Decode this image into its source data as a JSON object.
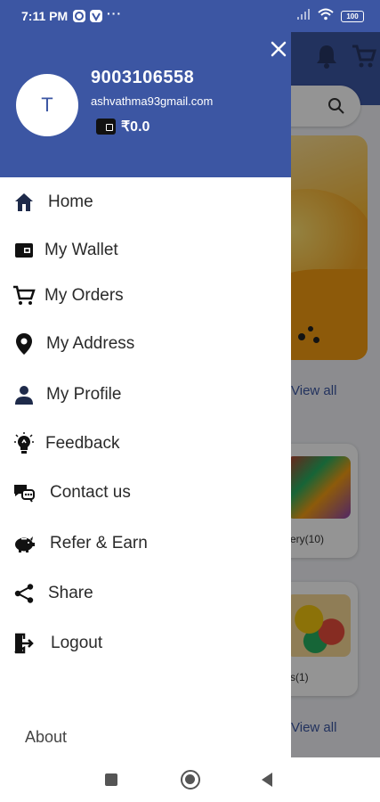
{
  "status_bar": {
    "time": "7:11 PM",
    "more_indicator": "···",
    "battery": "100"
  },
  "drawer": {
    "avatar_initial": "T",
    "phone": "9003106558",
    "email": "ashvathma93gmail.com",
    "balance": "₹0.0",
    "menu": [
      {
        "label": "Home",
        "icon": "home-icon"
      },
      {
        "label": "My Wallet",
        "icon": "wallet-icon"
      },
      {
        "label": "My Orders",
        "icon": "cart-icon"
      },
      {
        "label": "My Address",
        "icon": "location-pin-icon"
      },
      {
        "label": "My Profile",
        "icon": "person-icon"
      },
      {
        "label": "Feedback",
        "icon": "lightbulb-icon"
      },
      {
        "label": "Contact us",
        "icon": "chat-icon"
      },
      {
        "label": "Refer & Earn",
        "icon": "piggy-bank-icon"
      },
      {
        "label": "Share",
        "icon": "share-icon"
      },
      {
        "label": "Logout",
        "icon": "logout-icon"
      }
    ],
    "about": "About"
  },
  "background": {
    "view_all": "View all",
    "card1_caption": "ery(10)",
    "card2_caption": "s(1)"
  },
  "colors": {
    "primary": "#3c56a3",
    "icon_dark": "#1e2a4a"
  }
}
